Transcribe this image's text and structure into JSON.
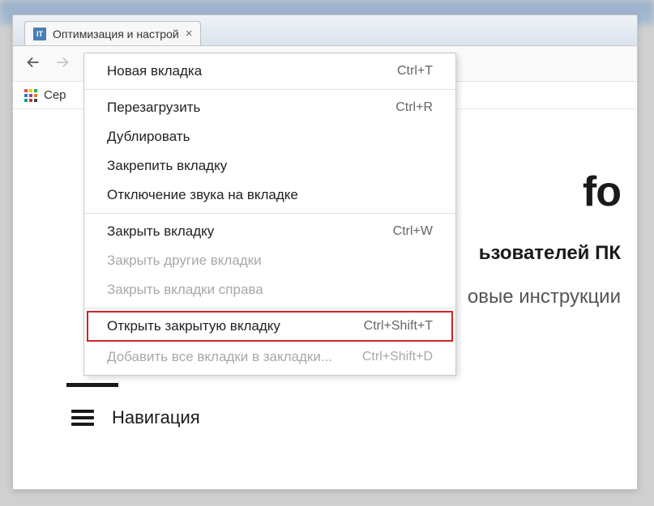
{
  "window": {
    "tab": {
      "favicon_text": "IT",
      "title": "Оптимизация и настрой"
    },
    "bookmarks": {
      "services_label": "Сер"
    }
  },
  "page": {
    "heading_fragment": "fo",
    "sub_heading": "ьзователей ПК",
    "sub_text": "овые инструкции",
    "navigation_label": "Навигация"
  },
  "context_menu": {
    "items": [
      {
        "label": "Новая вкладка",
        "shortcut": "Ctrl+T",
        "disabled": false,
        "sep_after": true
      },
      {
        "label": "Перезагрузить",
        "shortcut": "Ctrl+R",
        "disabled": false
      },
      {
        "label": "Дублировать",
        "shortcut": "",
        "disabled": false
      },
      {
        "label": "Закрепить вкладку",
        "shortcut": "",
        "disabled": false
      },
      {
        "label": "Отключение звука на вкладке",
        "shortcut": "",
        "disabled": false,
        "sep_after": true
      },
      {
        "label": "Закрыть вкладку",
        "shortcut": "Ctrl+W",
        "disabled": false
      },
      {
        "label": "Закрыть другие вкладки",
        "shortcut": "",
        "disabled": true
      },
      {
        "label": "Закрыть вкладки справа",
        "shortcut": "",
        "disabled": true,
        "sep_after": true
      },
      {
        "label": "Открыть закрытую вкладку",
        "shortcut": "Ctrl+Shift+T",
        "disabled": false,
        "highlight": true
      },
      {
        "label": "Добавить все вкладки в закладки...",
        "shortcut": "Ctrl+Shift+D",
        "disabled": true
      }
    ]
  }
}
